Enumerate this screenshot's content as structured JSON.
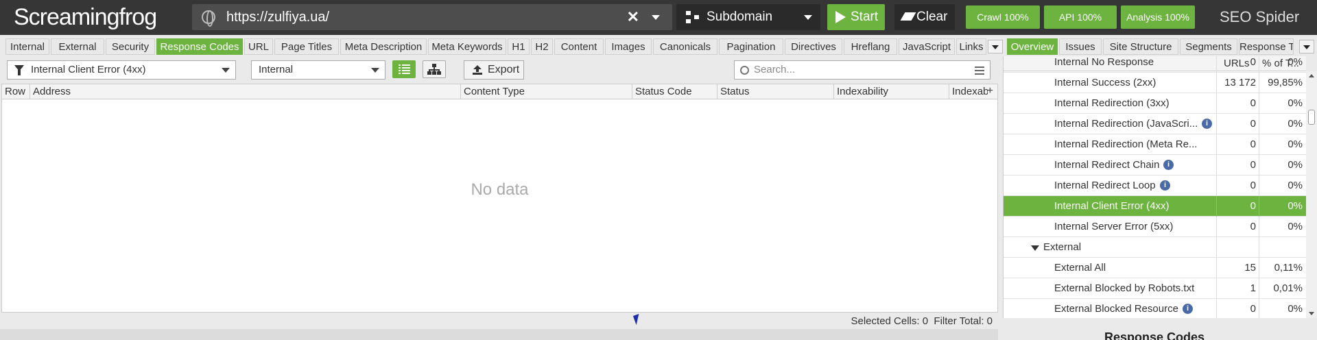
{
  "topbar": {
    "logo": "Screamingfrog",
    "url": "https://zulfiya.ua/",
    "mode": "Subdomain",
    "start": "Start",
    "clear": "Clear",
    "crawl": "Crawl 100%",
    "api": "API 100%",
    "analysis": "Analysis 100%",
    "product": "SEO Spider"
  },
  "main_tabs": [
    "Internal",
    "External",
    "Security",
    "Response Codes",
    "URL",
    "Page Titles",
    "Meta Description",
    "Meta Keywords",
    "H1",
    "H2",
    "Content",
    "Images",
    "Canonicals",
    "Pagination",
    "Directives",
    "Hreflang",
    "JavaScript",
    "Links"
  ],
  "right_tabs": [
    "Overview",
    "Issues",
    "Site Structure",
    "Segments",
    "Response T"
  ],
  "filter": {
    "selected": "Internal Client Error (4xx)",
    "scope": "Internal",
    "export": "Export",
    "search_placeholder": "Search..."
  },
  "grid": {
    "columns": [
      "Row",
      "Address",
      "Content Type",
      "Status Code",
      "Status",
      "Indexability",
      "Indexab"
    ],
    "empty": "No data",
    "selected_cells": "Selected Cells:  0",
    "filter_total": "Filter Total:  0"
  },
  "overview": {
    "col_urls": "URLs",
    "col_pct": "% of T...",
    "rows": [
      {
        "name": "Internal No Response",
        "urls": "0",
        "pct": "0%",
        "info": false
      },
      {
        "name": "Internal Success (2xx)",
        "urls": "13 172",
        "pct": "99,85%",
        "info": false
      },
      {
        "name": "Internal Redirection (3xx)",
        "urls": "0",
        "pct": "0%",
        "info": false
      },
      {
        "name": "Internal Redirection (JavaScri...",
        "urls": "0",
        "pct": "0%",
        "info": true
      },
      {
        "name": "Internal Redirection (Meta Re...",
        "urls": "0",
        "pct": "0%",
        "info": false
      },
      {
        "name": "Internal Redirect Chain",
        "urls": "0",
        "pct": "0%",
        "info": true
      },
      {
        "name": "Internal Redirect Loop",
        "urls": "0",
        "pct": "0%",
        "info": true
      },
      {
        "name": "Internal Client Error (4xx)",
        "urls": "0",
        "pct": "0%",
        "info": false
      },
      {
        "name": "Internal Server Error (5xx)",
        "urls": "0",
        "pct": "0%",
        "info": false
      },
      {
        "name": "External",
        "urls": "",
        "pct": "",
        "info": false
      },
      {
        "name": "External All",
        "urls": "15",
        "pct": "0,11%",
        "info": false
      },
      {
        "name": "External Blocked by Robots.txt",
        "urls": "1",
        "pct": "0,01%",
        "info": false
      },
      {
        "name": "External Blocked Resource",
        "urls": "0",
        "pct": "0%",
        "info": true
      }
    ],
    "chart_title": "Response Codes"
  },
  "colors": {
    "accent": "#6cb33f",
    "topbar": "#363636"
  }
}
